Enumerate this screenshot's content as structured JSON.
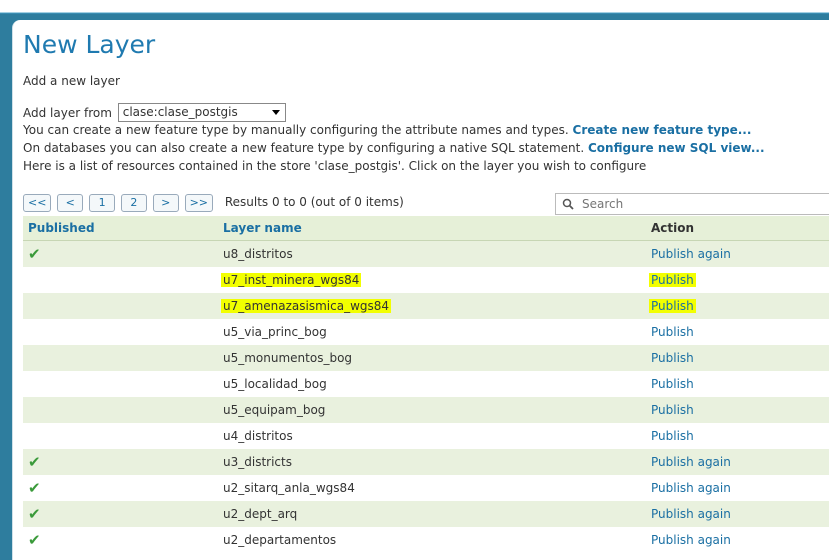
{
  "page": {
    "title": "New Layer",
    "subtitle": "Add a new layer"
  },
  "store": {
    "label": "Add layer from",
    "selected": "clase:clase_postgis"
  },
  "info": {
    "line1_text": "You can create a new feature type by manually configuring the attribute names and types.",
    "line1_link": "Create new feature type...",
    "line2_text": "On databases you can also create a new feature type by configuring a native SQL statement.",
    "line2_link": "Configure new SQL view...",
    "line3_text": "Here is a list of resources contained in the store 'clase_postgis'. Click on the layer you wish to configure"
  },
  "pager": {
    "first": "<<",
    "prev": "<",
    "page1": "1",
    "page2": "2",
    "next": ">",
    "last": ">>",
    "info": "Results 0 to 0 (out of 0 items)"
  },
  "search": {
    "placeholder": "Search"
  },
  "table": {
    "headers": {
      "published": "Published",
      "layer_name": "Layer name",
      "action": "Action"
    },
    "rows": [
      {
        "published": true,
        "name": "u8_distritos",
        "action": "Publish again",
        "highlight": false
      },
      {
        "published": false,
        "name": "u7_inst_minera_wgs84",
        "action": "Publish",
        "highlight": true
      },
      {
        "published": false,
        "name": "u7_amenazasismica_wgs84",
        "action": "Publish",
        "highlight": true
      },
      {
        "published": false,
        "name": "u5_via_princ_bog",
        "action": "Publish",
        "highlight": false
      },
      {
        "published": false,
        "name": "u5_monumentos_bog",
        "action": "Publish",
        "highlight": false
      },
      {
        "published": false,
        "name": "u5_localidad_bog",
        "action": "Publish",
        "highlight": false
      },
      {
        "published": false,
        "name": "u5_equipam_bog",
        "action": "Publish",
        "highlight": false
      },
      {
        "published": false,
        "name": "u4_distritos",
        "action": "Publish",
        "highlight": false
      },
      {
        "published": true,
        "name": "u3_districts",
        "action": "Publish again",
        "highlight": false
      },
      {
        "published": true,
        "name": "u2_sitarq_anla_wgs84",
        "action": "Publish again",
        "highlight": false
      },
      {
        "published": true,
        "name": "u2_dept_arq",
        "action": "Publish again",
        "highlight": false
      },
      {
        "published": true,
        "name": "u2_departamentos",
        "action": "Publish again",
        "highlight": false
      }
    ]
  },
  "icons": {
    "published_check": "check-icon",
    "search": "magnifier-icon"
  },
  "colors": {
    "accent": "#1f7ab0",
    "row_alt": "#e9f1de",
    "highlight": "#f2ff00",
    "check": "#3a9a3a"
  }
}
